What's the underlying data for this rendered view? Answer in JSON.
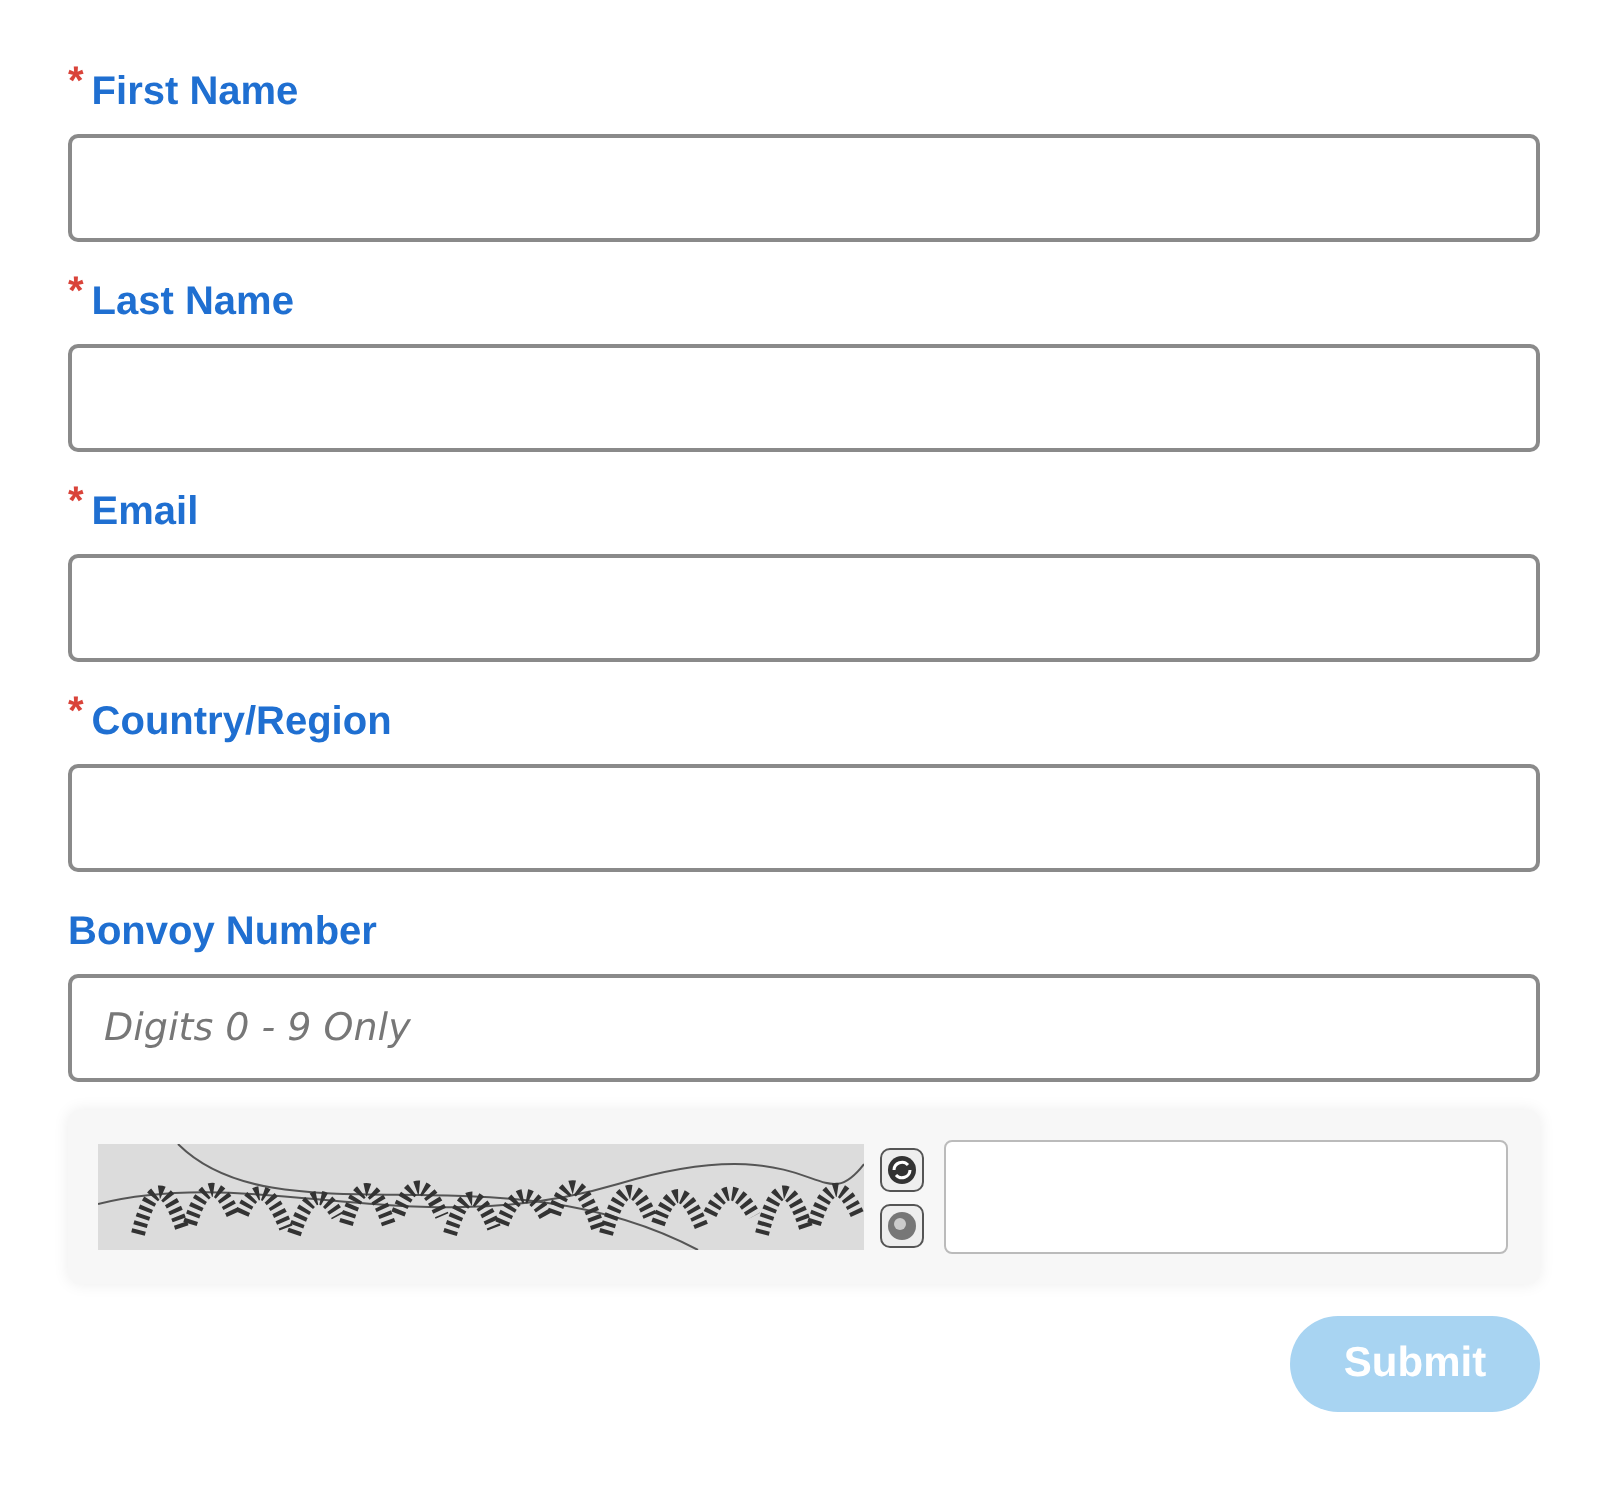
{
  "fields": [
    {
      "label": "First Name",
      "required_mark": "*"
    },
    {
      "label": "Last Name",
      "required_mark": "*"
    },
    {
      "label": "Email",
      "required_mark": "*"
    },
    {
      "label": "Country/Region",
      "required_mark": "*"
    },
    {
      "label": "Bonvoy Number",
      "placeholder": "Digits 0 - 9 Only"
    }
  ],
  "submit": {
    "label": "Submit",
    "disabled": true
  }
}
